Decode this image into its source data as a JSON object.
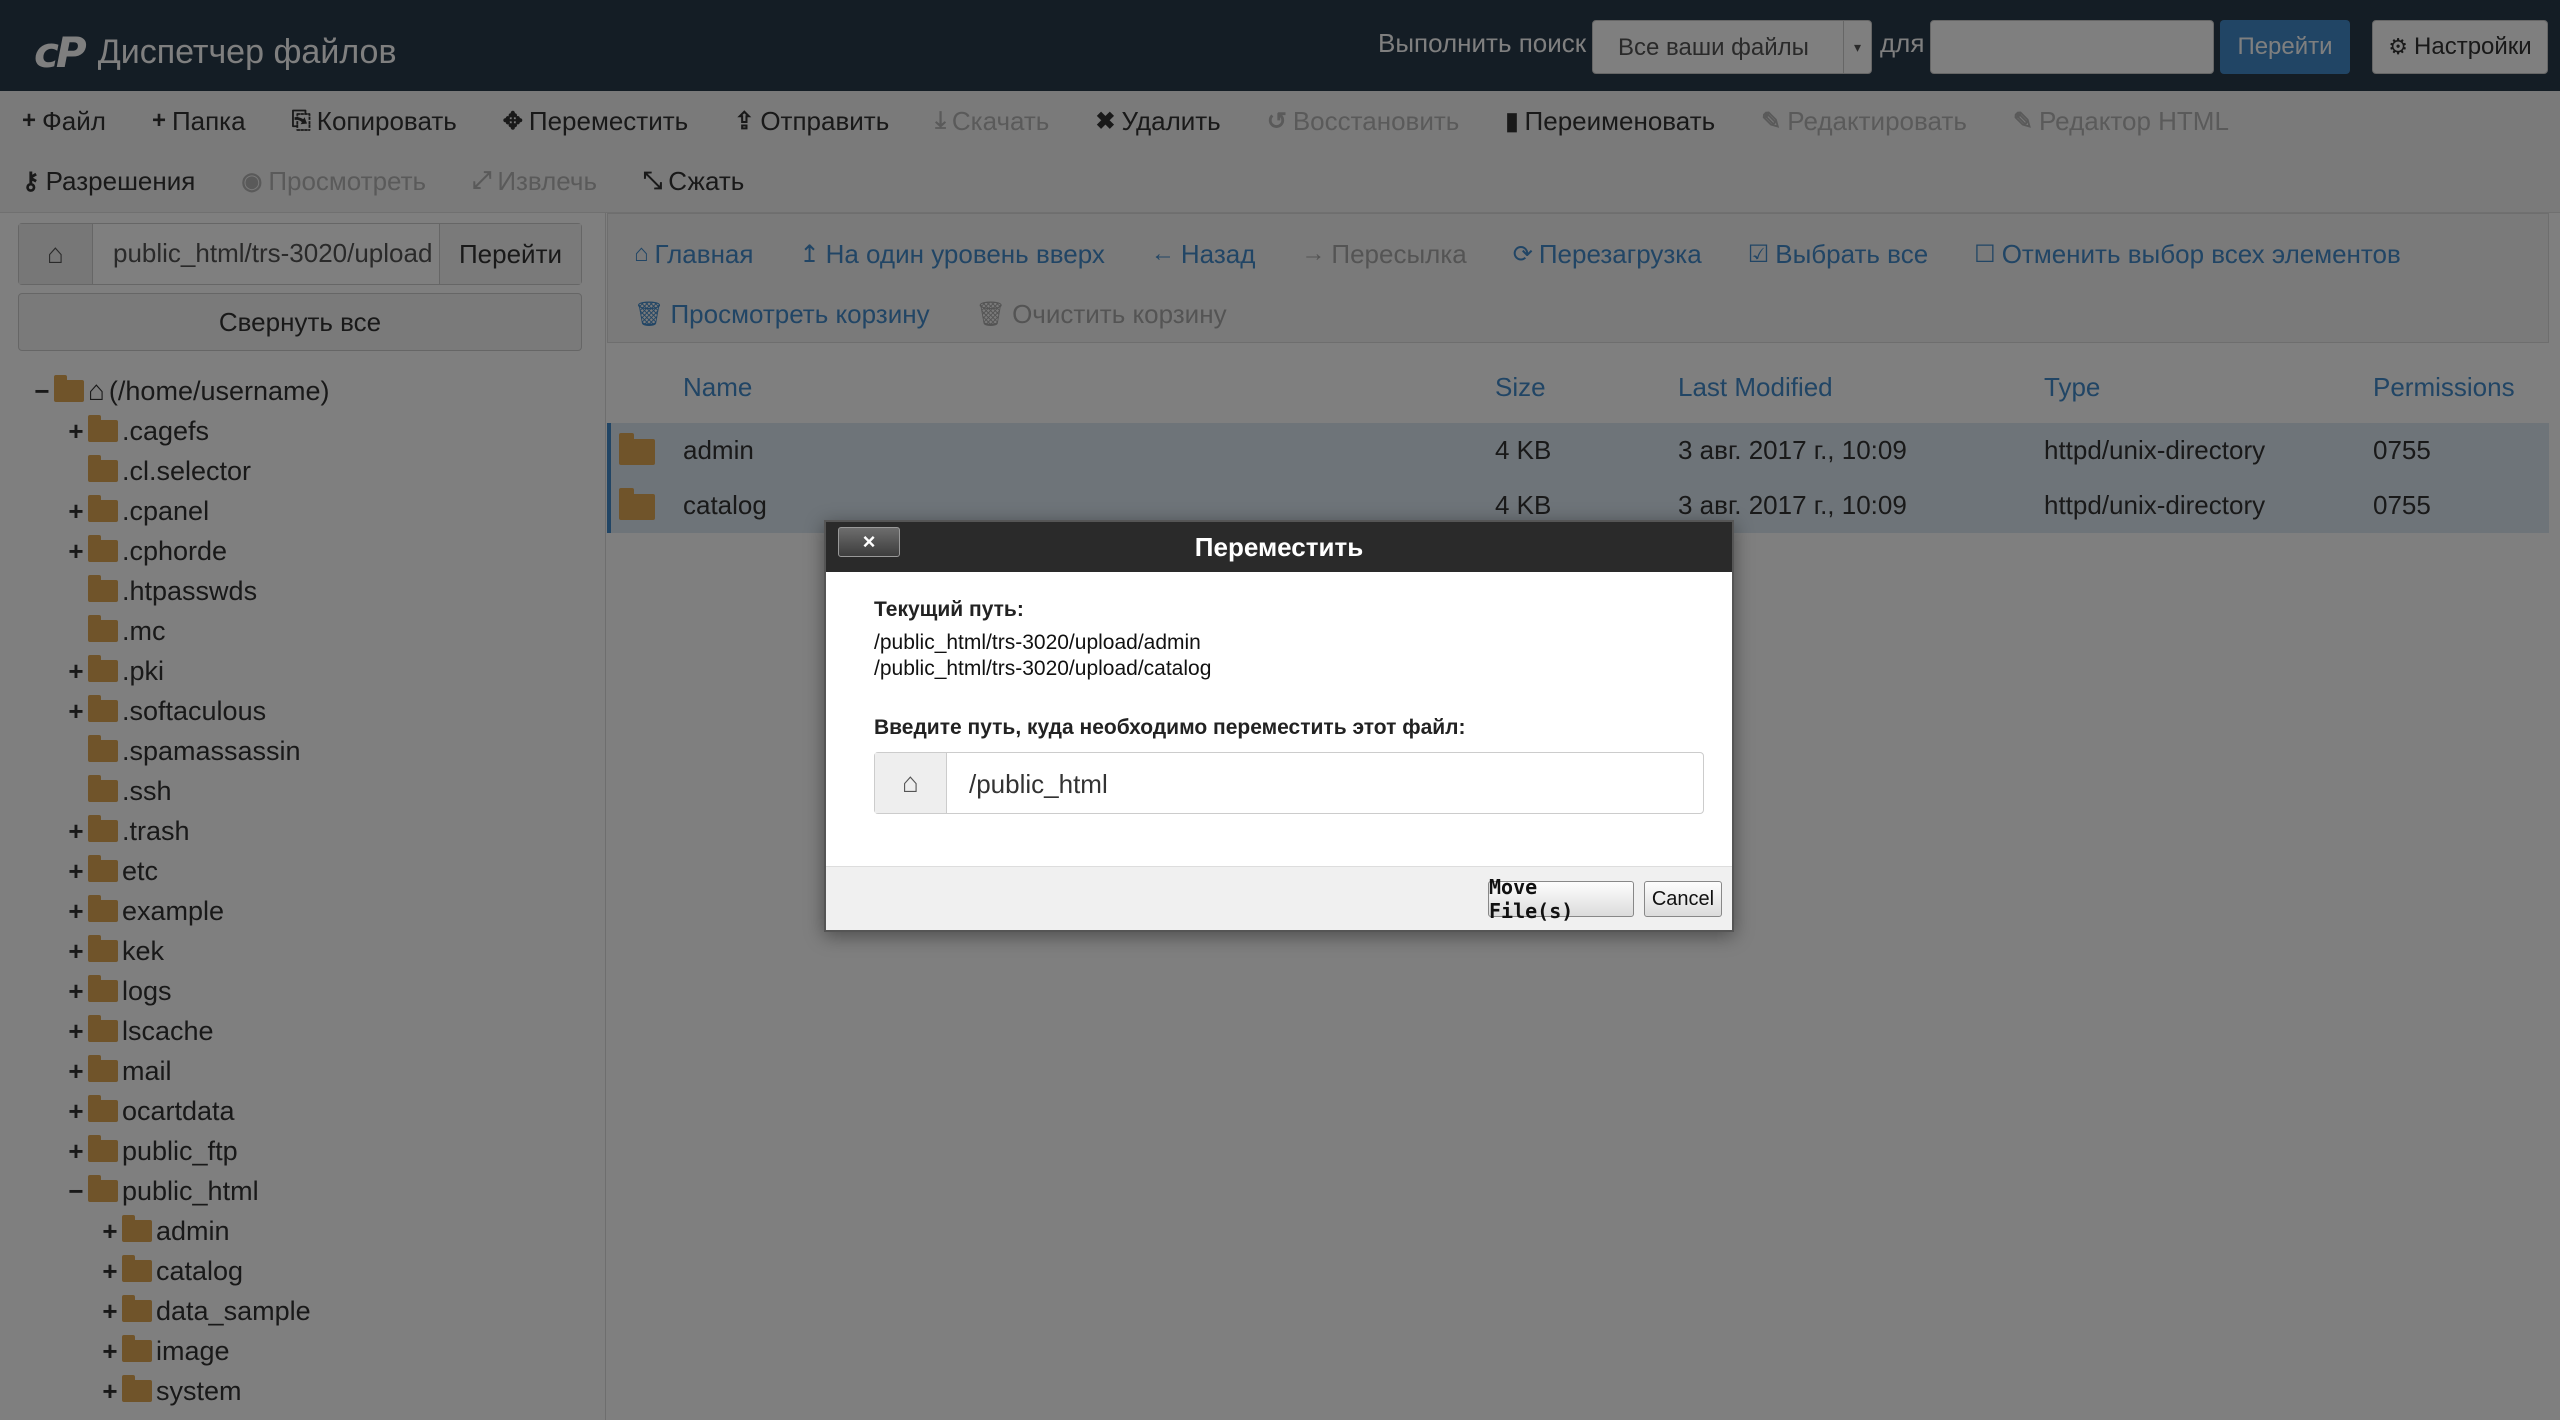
{
  "header": {
    "logo_text": "cP",
    "app_title": "Диспетчер файлов",
    "search_label": "Выполнить поиск",
    "search_scope": "Все ваши файлы",
    "for_label": "для",
    "search_value": "",
    "go_label": "Перейти",
    "settings_label": "Настройки"
  },
  "toolbar": {
    "row1": [
      {
        "icon": "plus-icon",
        "glyph": "+",
        "label": "Файл",
        "enabled": true
      },
      {
        "icon": "plus-icon",
        "glyph": "+",
        "label": "Папка",
        "enabled": true
      },
      {
        "icon": "copy-icon",
        "glyph": "⎘",
        "label": "Копировать",
        "enabled": true
      },
      {
        "icon": "move-icon",
        "glyph": "✥",
        "label": "Переместить",
        "enabled": true
      },
      {
        "icon": "upload-icon",
        "glyph": "⇪",
        "label": "Отправить",
        "enabled": true
      },
      {
        "icon": "download-icon",
        "glyph": "⤓",
        "label": "Скачать",
        "enabled": false
      },
      {
        "icon": "delete-icon",
        "glyph": "✖",
        "label": "Удалить",
        "enabled": true
      },
      {
        "icon": "restore-icon",
        "glyph": "↺",
        "label": "Восстановить",
        "enabled": false
      },
      {
        "icon": "file-icon",
        "glyph": "▮",
        "label": "Переименовать",
        "enabled": true
      },
      {
        "icon": "pencil-icon",
        "glyph": "✎",
        "label": "Редактировать",
        "enabled": false
      },
      {
        "icon": "html-editor-icon",
        "glyph": "✎",
        "label": "Редактор HTML",
        "enabled": false
      }
    ],
    "row2": [
      {
        "icon": "key-icon",
        "glyph": "⚷",
        "label": "Разрешения",
        "enabled": true
      },
      {
        "icon": "eye-icon",
        "glyph": "◉",
        "label": "Просмотреть",
        "enabled": false
      },
      {
        "icon": "extract-icon",
        "glyph": "⤢",
        "label": "Извлечь",
        "enabled": false
      },
      {
        "icon": "compress-icon",
        "glyph": "⤡",
        "label": "Сжать",
        "enabled": true
      }
    ]
  },
  "left": {
    "path_value": "public_html/trs-3020/upload",
    "path_go": "Перейти",
    "collapse_all": "Свернуть все",
    "tree": [
      {
        "toggle": "−",
        "label": "(/home/username)",
        "level": 0,
        "home": true
      },
      {
        "toggle": "+",
        "label": ".cagefs",
        "level": 1
      },
      {
        "toggle": "",
        "label": ".cl.selector",
        "level": 1
      },
      {
        "toggle": "+",
        "label": ".cpanel",
        "level": 1
      },
      {
        "toggle": "+",
        "label": ".cphorde",
        "level": 1
      },
      {
        "toggle": "",
        "label": ".htpasswds",
        "level": 1
      },
      {
        "toggle": "",
        "label": ".mc",
        "level": 1
      },
      {
        "toggle": "+",
        "label": ".pki",
        "level": 1
      },
      {
        "toggle": "+",
        "label": ".softaculous",
        "level": 1
      },
      {
        "toggle": "",
        "label": ".spamassassin",
        "level": 1
      },
      {
        "toggle": "",
        "label": ".ssh",
        "level": 1
      },
      {
        "toggle": "+",
        "label": ".trash",
        "level": 1
      },
      {
        "toggle": "+",
        "label": "etc",
        "level": 1
      },
      {
        "toggle": "+",
        "label": "example",
        "level": 1
      },
      {
        "toggle": "+",
        "label": "kek",
        "level": 1
      },
      {
        "toggle": "+",
        "label": "logs",
        "level": 1
      },
      {
        "toggle": "+",
        "label": "lscache",
        "level": 1
      },
      {
        "toggle": "+",
        "label": "mail",
        "level": 1
      },
      {
        "toggle": "+",
        "label": "ocartdata",
        "level": 1
      },
      {
        "toggle": "+",
        "label": "public_ftp",
        "level": 1
      },
      {
        "toggle": "−",
        "label": "public_html",
        "level": 1
      },
      {
        "toggle": "+",
        "label": "admin",
        "level": 2
      },
      {
        "toggle": "+",
        "label": "catalog",
        "level": 2
      },
      {
        "toggle": "+",
        "label": "data_sample",
        "level": 2
      },
      {
        "toggle": "+",
        "label": "image",
        "level": 2
      },
      {
        "toggle": "+",
        "label": "system",
        "level": 2
      }
    ]
  },
  "nav": {
    "row1": [
      {
        "icon": "home-icon",
        "glyph": "⌂",
        "label": "Главная",
        "enabled": true
      },
      {
        "icon": "level-up-icon",
        "glyph": "↥",
        "label": "На один уровень вверх",
        "enabled": true
      },
      {
        "icon": "back-icon",
        "glyph": "←",
        "label": "Назад",
        "enabled": true
      },
      {
        "icon": "forward-icon",
        "glyph": "→",
        "label": "Пересылка",
        "enabled": false
      },
      {
        "icon": "reload-icon",
        "glyph": "⟳",
        "label": "Перезагрузка",
        "enabled": true
      },
      {
        "icon": "check-square-icon",
        "glyph": "☑",
        "label": "Выбрать все",
        "enabled": true
      },
      {
        "icon": "square-icon",
        "glyph": "☐",
        "label": "Отменить выбор всех элементов",
        "enabled": true
      }
    ],
    "row2": [
      {
        "icon": "trash-icon",
        "glyph": "🗑",
        "label": "Просмотреть корзину",
        "enabled": true
      },
      {
        "icon": "trash-icon",
        "glyph": "🗑",
        "label": "Очистить корзину",
        "enabled": false
      }
    ]
  },
  "table": {
    "columns": [
      "Name",
      "Size",
      "Last Modified",
      "Type",
      "Permissions"
    ],
    "rows": [
      {
        "name": "admin",
        "size": "4 KB",
        "modified": "3 авг. 2017 г., 10:09",
        "type": "httpd/unix-directory",
        "perms": "0755"
      },
      {
        "name": "catalog",
        "size": "4 KB",
        "modified": "3 авг. 2017 г., 10:09",
        "type": "httpd/unix-directory",
        "perms": "0755"
      }
    ]
  },
  "dialog": {
    "title": "Переместить",
    "close": "×",
    "current_path_label": "Текущий путь:",
    "paths": [
      "/public_html/trs-3020/upload/admin",
      "/public_html/trs-3020/upload/catalog"
    ],
    "dest_label": "Введите путь, куда необходимо переместить этот файл:",
    "dest_value": "/public_html",
    "move_label": "Move File(s)",
    "cancel_label": "Cancel"
  }
}
